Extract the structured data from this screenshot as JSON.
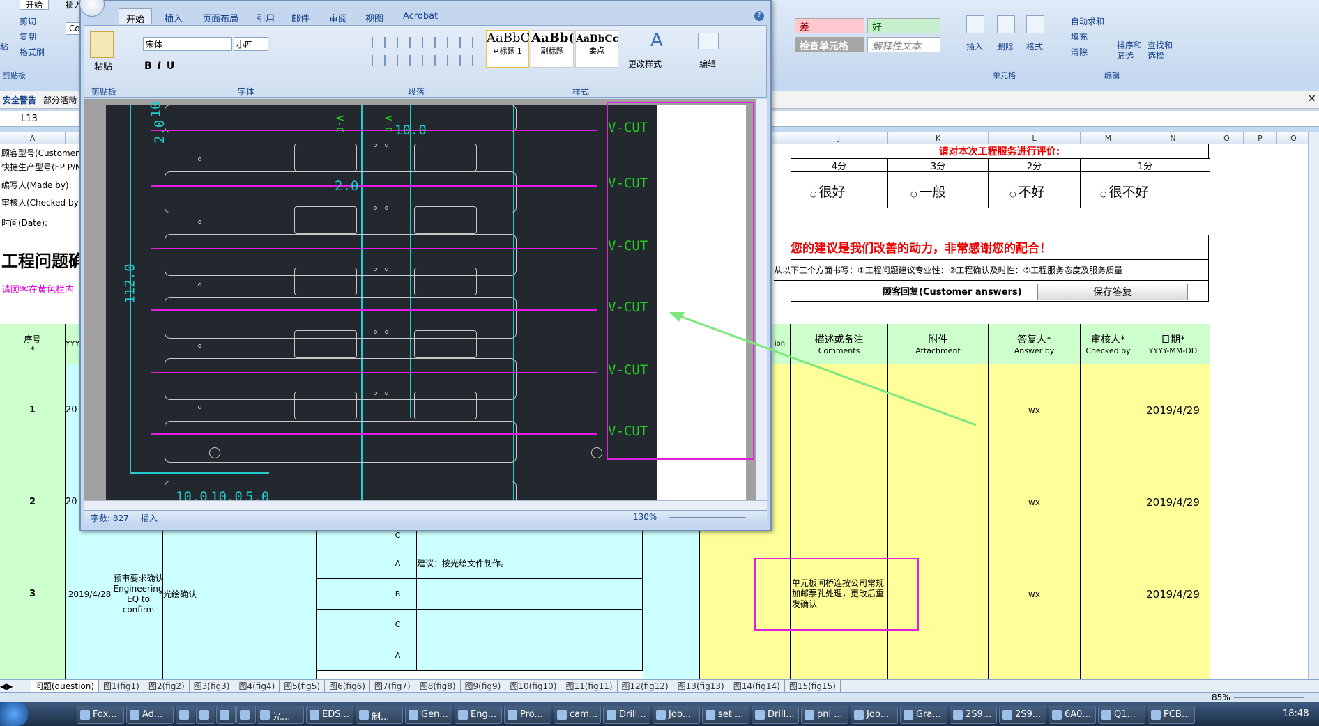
{
  "excel": {
    "tabs": [
      "开始",
      "插入"
    ],
    "clipboard": {
      "cut": "剪切",
      "copy": "复制",
      "format_painter": "格式刷",
      "paste": "粘",
      "label": "剪贴板"
    },
    "font_box": "Co",
    "styles": {
      "bad": "差",
      "good": "好",
      "check_cell": "检查单元格",
      "explanatory": "解释性文本"
    },
    "cells_group": {
      "insert": "插入",
      "delete": "删除",
      "format": "格式",
      "label": "单元格"
    },
    "edit_group": {
      "autosum": "自动求和",
      "fill": "填充",
      "clear": "清除",
      "sort": "排序和\n筛选",
      "find": "查找和\n选择",
      "label": "编辑"
    },
    "security_warning": "安全警告",
    "security_text": "部分活动",
    "name_box": "L13",
    "columns": [
      "A",
      "J",
      "K",
      "L",
      "M",
      "N",
      "O",
      "P",
      "Q"
    ],
    "left_labels": [
      "顾客型号(Customer P",
      "快捷生产型号(FP P/N",
      "编写人(Made by):",
      "审核人(Checked by):",
      "时间(Date):"
    ],
    "big_title": "工程问题确",
    "pink_note": "请顾客在黄色栏内",
    "rating_title": "请对本次工程服务进行评价:",
    "rating_headers": [
      "4分",
      "3分",
      "2分",
      "1分"
    ],
    "rating_options": [
      "很好",
      "一般",
      "不好",
      "很不好"
    ],
    "thanks": "您的建议是我们改善的动力，非常感谢您的配合！",
    "fill_hint": "从以下三个方面书写：①工程问题建议专业性：②工程确认及时性：⑤工程服务态度及服务质量",
    "customer_answers": "顾客回复(Customer answers)",
    "save_button": "保存答复",
    "header_seq": "序号\n*",
    "header_yyy": "YYY",
    "header_ion": "ion",
    "headers": [
      {
        "cn": "描述或备注",
        "en": "Comments"
      },
      {
        "cn": "附件",
        "en": "Attachment"
      },
      {
        "cn": "答复人*",
        "en": "Answer by"
      },
      {
        "cn": "审核人*",
        "en": "Checked by"
      },
      {
        "cn": "日期*",
        "en": "YYYY-MM-DD"
      }
    ],
    "rows": [
      {
        "num": "1",
        "date_part": "20",
        "answer_by": "wx",
        "date": "2019/4/29"
      },
      {
        "num": "2",
        "date_part": "20",
        "answer_by": "wx",
        "date": "2019/4/29"
      },
      {
        "num": "3",
        "date_full": "2019/4/28",
        "type": "预审要求确认 Engineering EQ to confirm",
        "topic": "光绘确认",
        "abc": [
          "A",
          "B",
          "C"
        ],
        "suggestion": "建议：按光绘文件制作。",
        "comment": "单元板间桥连按公司常规加邮票孔处理，更改后重发确认",
        "answer_by": "wx",
        "date": "2019/4/29"
      }
    ],
    "row2_c": "C",
    "row4_a": "A",
    "sheet_tabs": [
      "问题(question)",
      "图1(fig1)",
      "图2(fig2)",
      "图3(fig3)",
      "图4(fig4)",
      "图5(fig5)",
      "图6(fig6)",
      "图7(fig7)",
      "图8(fig8)",
      "图9(fig9)",
      "图10(fig10)",
      "图11(fig11)",
      "图12(fig12)",
      "图13(fig13)",
      "图14(fig14)",
      "图15(fig15)"
    ],
    "zoom": "85%"
  },
  "word": {
    "tabs": [
      "开始",
      "插入",
      "页面布局",
      "引用",
      "邮件",
      "审阅",
      "视图",
      "Acrobat"
    ],
    "font_name": "宋体",
    "font_size": "小四",
    "styles": [
      {
        "sample": "AaBbC",
        "name": "↵标题 1"
      },
      {
        "sample": "AaBb(",
        "name": "副标题"
      },
      {
        "sample": "AaBbCcD",
        "name": "要点"
      }
    ],
    "change_styles": "更改样式",
    "edit": "编辑",
    "paste": "粘贴",
    "groups": [
      "剪贴板",
      "字体",
      "段落",
      "样式"
    ],
    "word_count": "字数: 827",
    "insert_mode": "插入",
    "zoom": "130%",
    "cad": {
      "vcut": [
        "V-CUT",
        "V-CUT",
        "V-CUT",
        "V-CUT",
        "V-CUT",
        "V-CUT"
      ],
      "dims": [
        "2.0",
        "10",
        "10.0",
        "2.0",
        "112.0",
        "10.0",
        "10.0",
        "5.0"
      ],
      "vlabels": [
        "V-C",
        "V-C"
      ]
    }
  },
  "taskbar": {
    "items": [
      "Fox...",
      "Ad...",
      "",
      "",
      "",
      "",
      "光...",
      "EDS...",
      "制...",
      "Gen...",
      "Eng...",
      "Pro...",
      "cam...",
      "Drill...",
      "Job...",
      "set ...",
      "Drill...",
      "pnl ...",
      "Job...",
      "Gra...",
      "2S9...",
      "2S9...",
      "6A0...",
      "Q1...",
      "PCB..."
    ],
    "time": "18:48"
  }
}
